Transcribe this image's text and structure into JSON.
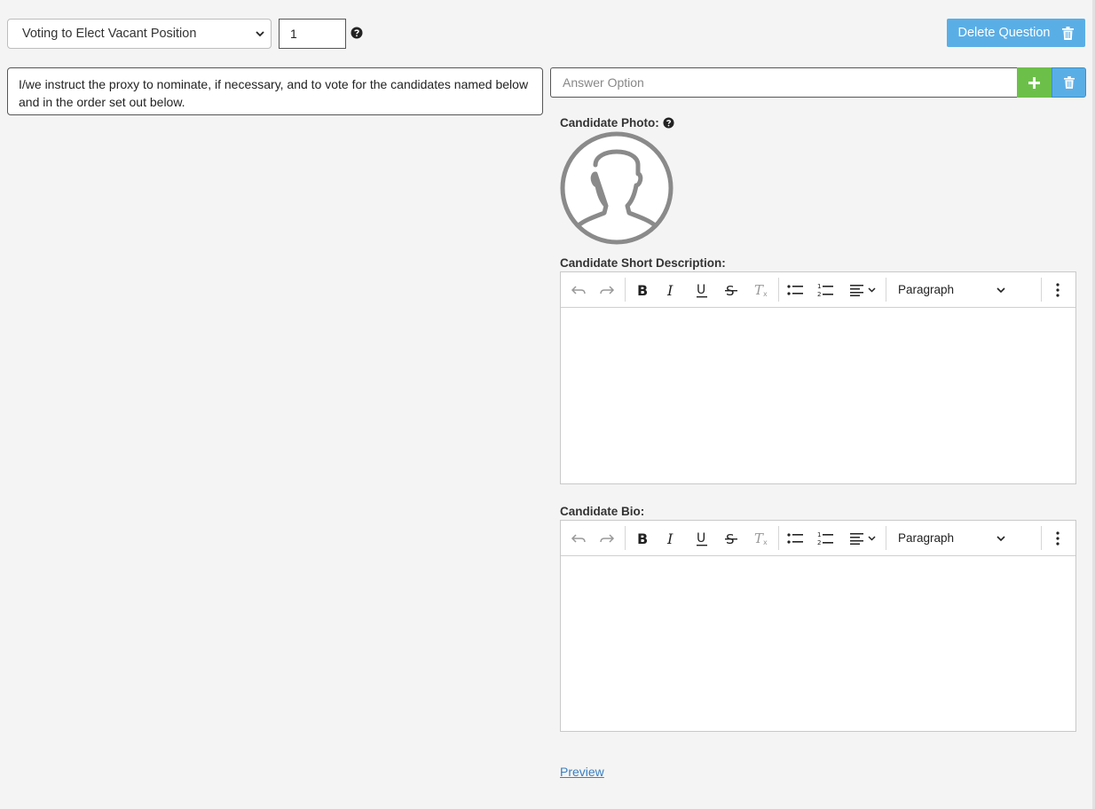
{
  "question": {
    "type_selected": "Voting to Elect Vacant Position",
    "count_value": "1",
    "delete_label": "Delete Question",
    "text": "I/we instruct the proxy to nominate, if necessary, and to vote for the candidates named below and in the order set out below."
  },
  "answer": {
    "placeholder": "Answer Option",
    "add_icon": "plus-icon",
    "remove_icon": "trash-icon"
  },
  "candidate": {
    "photo_label": "Candidate Photo:",
    "short_desc_label": "Candidate Short Description:",
    "bio_label": "Candidate Bio:"
  },
  "editor": {
    "block_format": "Paragraph"
  },
  "preview_link": "Preview",
  "colors": {
    "primary": "#5aaee6",
    "success": "#6cc04a",
    "background": "#f4f4f4"
  }
}
